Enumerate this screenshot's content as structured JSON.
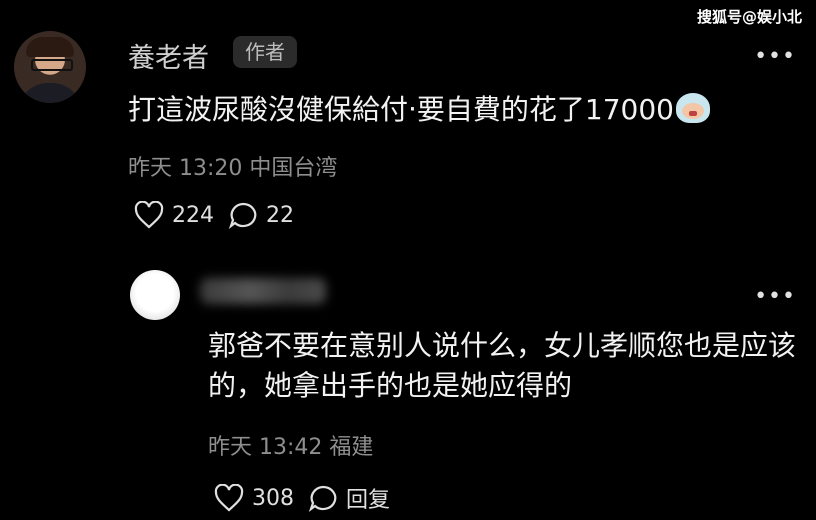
{
  "watermark": "搜狐号@娱小北",
  "comment1": {
    "username": "養老者",
    "author_tag": "作者",
    "text": "打這波尿酸沒健保給付‧要自費的花了17000",
    "emoji": "crying-face-emoji",
    "time": "昨天 13:20",
    "location": "中国台湾",
    "likes": "224",
    "replies": "22"
  },
  "comment2": {
    "text": "郭爸不要在意别人说什么，女儿孝顺您也是应该的，她拿出手的也是她应得的",
    "time": "昨天 13:42",
    "location": "福建",
    "likes": "308",
    "reply_label": "回复"
  },
  "icons": [
    "heart-icon",
    "comment-bubble-icon",
    "more-icon"
  ]
}
